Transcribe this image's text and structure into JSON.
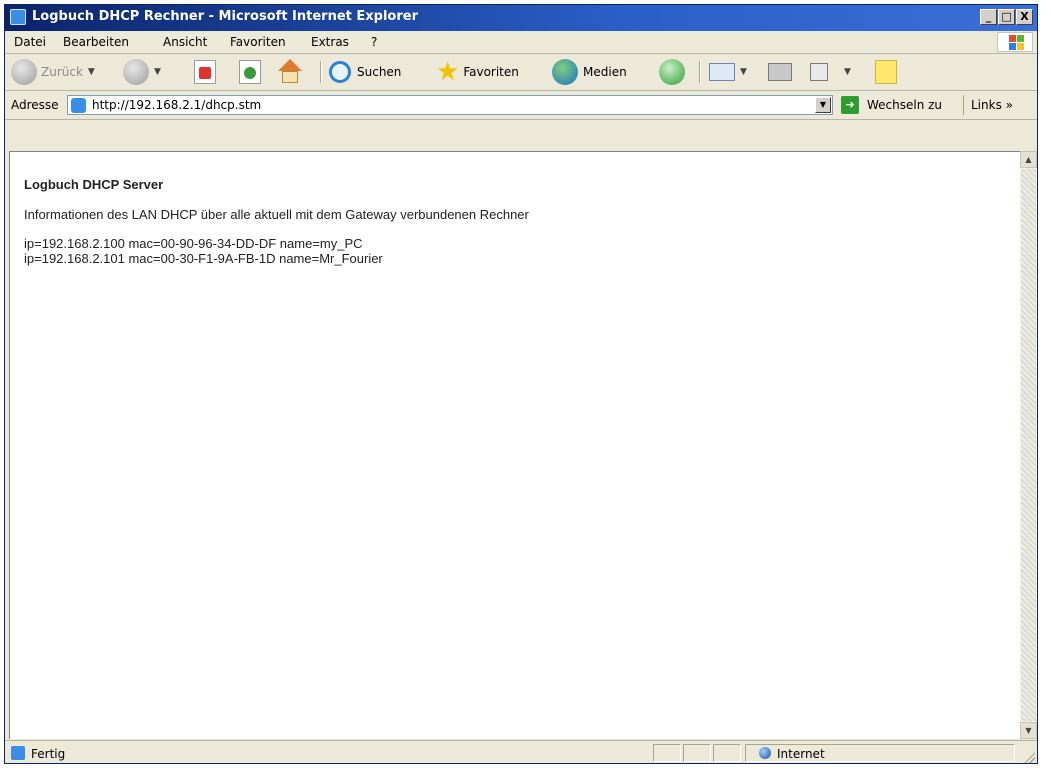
{
  "window": {
    "title": "Logbuch DHCP Rechner - Microsoft Internet Explorer",
    "controls": [
      "_",
      "□",
      "X"
    ]
  },
  "menu": [
    "Datei",
    "Bearbeiten",
    "Ansicht",
    "Favoriten",
    "Extras",
    "?"
  ],
  "toolbar": {
    "back_label": "Zurück",
    "search_label": "Suchen",
    "favorites_label": "Favoriten",
    "media_label": "Medien"
  },
  "address": {
    "label": "Adresse",
    "url": "http://192.168.2.1/dhcp.stm",
    "go_label": "Wechseln zu",
    "links_label": "Links",
    "links_chevron": "»"
  },
  "page": {
    "heading": "Logbuch DHCP Server",
    "description": "Informationen des LAN DHCP über alle aktuell mit dem Gateway verbundenen Rechner",
    "entries": [
      "ip=192.168.2.100 mac=00-90-96-34-DD-DF name=my_PC",
      "ip=192.168.2.101 mac=00-30-F1-9A-FB-1D name=Mr_Fourier"
    ]
  },
  "status": {
    "text": "Fertig",
    "zone": "Internet"
  }
}
